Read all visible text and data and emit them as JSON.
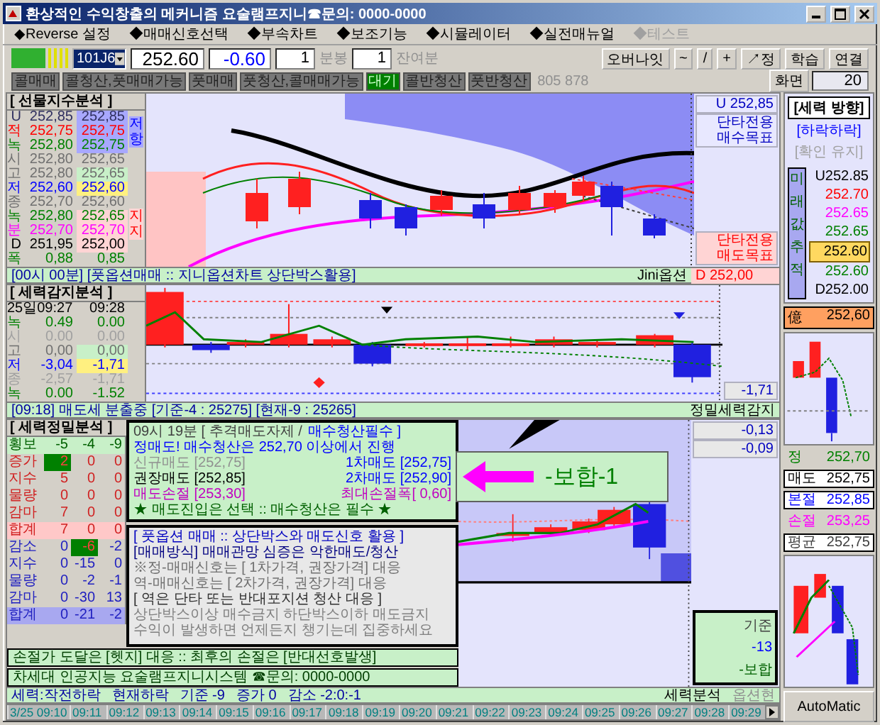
{
  "window": {
    "title": "환상적인 수익창출의 메커니즘 요술램프지니☎문의: 0000-0000"
  },
  "menu": [
    {
      "label": "◆Reverse 설정",
      "disabled": false
    },
    {
      "label": "◆매매신호선택",
      "disabled": false
    },
    {
      "label": "◆부속차트",
      "disabled": false
    },
    {
      "label": "◆보조기능",
      "disabled": false
    },
    {
      "label": "◆시뮬레이터",
      "disabled": false
    },
    {
      "label": "◆실전매뉴얼",
      "disabled": false
    },
    {
      "label": "◆테스트",
      "disabled": true
    }
  ],
  "toolbar": {
    "symbol": "101J6",
    "price": "252.60",
    "change": "-0.60",
    "interval": "1",
    "interval_unit": "분봉",
    "remaining": "1",
    "remaining_unit": "잔여분",
    "buttons": [
      "오버나잇",
      "~",
      "/",
      "+",
      "↗정",
      "학습",
      "연결"
    ]
  },
  "signals": [
    {
      "label": "콜매매",
      "active": false
    },
    {
      "label": "콜청산,풋매매가능",
      "active": false
    },
    {
      "label": "풋매매",
      "active": false
    },
    {
      "label": "풋청산,콜매매가능",
      "active": false
    },
    {
      "label": "대기",
      "active": true
    },
    {
      "label": "콜반청산",
      "active": false
    },
    {
      "label": "풋반청산",
      "active": false
    }
  ],
  "signal_counts": "805 878",
  "screen": {
    "label": "화면",
    "value": "20"
  },
  "futures": {
    "title": "[ 선물지수분석 ]",
    "resistance": "저항",
    "support": "지지",
    "rows": [
      {
        "label": "U",
        "color": "#303060",
        "values": [
          "252,85",
          "252,85"
        ],
        "kind": "resistance"
      },
      {
        "label": "적",
        "color": "#ff0000",
        "values": [
          "252,75",
          "252,75"
        ],
        "kind": "resistance"
      },
      {
        "label": "녹",
        "color": "#008000",
        "values": [
          "252,80",
          "252,75"
        ],
        "kind": "resistance"
      },
      {
        "label": "시",
        "color": "#707070",
        "values": [
          "252,80",
          "252,65"
        ],
        "kind": "plain"
      },
      {
        "label": "고",
        "color": "#707070",
        "values": [
          "252,80",
          "252,65"
        ],
        "kind": "high"
      },
      {
        "label": "저",
        "color": "#0000ff",
        "values": [
          "252,60",
          "252,60"
        ],
        "kind": "low"
      },
      {
        "label": "종",
        "color": "#707070",
        "values": [
          "252,70",
          "252,60"
        ],
        "kind": "plain"
      },
      {
        "label": "녹",
        "color": "#008000",
        "values": [
          "252,80",
          "252,65"
        ],
        "kind": "support"
      },
      {
        "label": "분",
        "color": "#ff00ff",
        "values": [
          "252,70",
          "252,70"
        ],
        "kind": "support"
      },
      {
        "label": "D",
        "color": "#000000",
        "values": [
          "251,95",
          "252,00"
        ],
        "kind": "support"
      },
      {
        "label": "폭",
        "color": "#008000",
        "values": [
          "0,88",
          "0,85"
        ],
        "kind": "plain"
      }
    ]
  },
  "futures_targets": {
    "upper": "U 252,85",
    "buy_target": "단타전용 매수목표",
    "sell_target": "단타전용 매도목표"
  },
  "futures_footer": {
    "text": "[00시 00분] [풋옵션매매 :: 지니옵션차트 상단박스활용]",
    "source": "Jini옵션",
    "lower": "D 252,00"
  },
  "detector": {
    "title": "[ 세력감지분석 ]",
    "columns": [
      "25일09:27",
      "09:28"
    ],
    "reading": "-1,71",
    "rows": [
      {
        "label": "녹",
        "color": "#008000",
        "values": [
          "0.49",
          "0.00"
        ],
        "kind": "plain"
      },
      {
        "label": "시",
        "color": "#a0a0a0",
        "values": [
          "0.00",
          "0.00"
        ],
        "kind": "plain"
      },
      {
        "label": "고",
        "color": "#707070",
        "values": [
          "0,00",
          "0,00"
        ],
        "kind": "high"
      },
      {
        "label": "저",
        "color": "#0000ff",
        "values": [
          "-3,04",
          "-1,71"
        ],
        "kind": "low"
      },
      {
        "label": "종",
        "color": "#a0a0a0",
        "values": [
          "-2,57",
          "-1,71"
        ],
        "kind": "plain"
      },
      {
        "label": "녹",
        "color": "#008000",
        "values": [
          "0.00",
          "-1.52"
        ],
        "kind": "plain"
      }
    ]
  },
  "detector_footer": {
    "text": "[09:18] 매도세 분출중 [기준-4 : 25275] [현재-9 : 25265]",
    "label": "정밀세력감지"
  },
  "precision": {
    "title": "[ 세력정밀분석 ]",
    "header": {
      "label": "횡보",
      "values": [
        "-5",
        "-4",
        "-9"
      ]
    },
    "rows": [
      {
        "label": "증가",
        "kind": "up",
        "values": [
          {
            "text": "2",
            "highlight": true
          },
          {
            "text": "0",
            "highlight": false
          },
          {
            "text": "0",
            "highlight": false
          }
        ]
      },
      {
        "label": "지수",
        "kind": "up",
        "values": [
          {
            "text": "5",
            "highlight": false
          },
          {
            "text": "0",
            "highlight": false
          },
          {
            "text": "0",
            "highlight": false
          }
        ]
      },
      {
        "label": "물량",
        "kind": "up",
        "values": [
          {
            "text": "0",
            "highlight": false
          },
          {
            "text": "0",
            "highlight": false
          },
          {
            "text": "0",
            "highlight": false
          }
        ]
      },
      {
        "label": "감마",
        "kind": "up",
        "values": [
          {
            "text": "7",
            "highlight": false
          },
          {
            "text": "0",
            "highlight": false
          },
          {
            "text": "0",
            "highlight": false
          }
        ]
      },
      {
        "label": "합계",
        "kind": "up_total",
        "values": [
          {
            "text": "7",
            "highlight": false
          },
          {
            "text": "0",
            "highlight": false
          },
          {
            "text": "0",
            "highlight": false
          }
        ]
      },
      {
        "label": "감소",
        "kind": "down",
        "values": [
          {
            "text": "0",
            "highlight": false
          },
          {
            "text": "-6",
            "highlight": true
          },
          {
            "text": "-2",
            "highlight": false
          }
        ]
      },
      {
        "label": "지수",
        "kind": "down",
        "values": [
          {
            "text": "0",
            "highlight": false
          },
          {
            "text": "-15",
            "highlight": false
          },
          {
            "text": "0",
            "highlight": false
          }
        ]
      },
      {
        "label": "물량",
        "kind": "down",
        "values": [
          {
            "text": "0",
            "highlight": false
          },
          {
            "text": "-2",
            "highlight": false
          },
          {
            "text": "-1",
            "highlight": false
          }
        ]
      },
      {
        "label": "감마",
        "kind": "down",
        "values": [
          {
            "text": "0",
            "highlight": false
          },
          {
            "text": "-30",
            "highlight": false
          },
          {
            "text": "13",
            "highlight": false
          }
        ]
      },
      {
        "label": "합계",
        "kind": "down_total",
        "values": [
          {
            "text": "0",
            "highlight": false
          },
          {
            "text": "-21",
            "highlight": false
          },
          {
            "text": "-2",
            "highlight": false
          }
        ]
      }
    ]
  },
  "advice": [
    {
      "kind": "single",
      "parts": [
        {
          "text": "09시 19분 [ 추격매도자제 /",
          "color": "#404040"
        },
        {
          "text": "매수청산필수 ]",
          "color": "#0000ff"
        }
      ]
    },
    {
      "kind": "single",
      "parts": [
        {
          "text": "정매도! 매수청산은 252,70 이상에서 진행",
          "color": "#0000ff"
        }
      ]
    },
    {
      "kind": "split",
      "parts": [
        {
          "text": "신규매도 [252,75]",
          "color": "#909090"
        },
        {
          "text": "1차매도 [252,75]",
          "color": "#0000ff"
        }
      ]
    },
    {
      "kind": "split",
      "parts": [
        {
          "text": "권장매도 [252,85]",
          "color": "#000000"
        },
        {
          "text": "2차매도 [252,90]",
          "color": "#0000ff"
        }
      ]
    },
    {
      "kind": "split",
      "parts": [
        {
          "text": "매도손절 [253,30]",
          "color": "#c000c0"
        },
        {
          "text": "최대손절폭[ 0,60]",
          "color": "#c000c0"
        }
      ]
    },
    {
      "kind": "single",
      "parts": [
        {
          "text": "★ 매도진입은 선택 :: 매수청산은 필수 ★",
          "color": "#006000"
        }
      ]
    }
  ],
  "strategy": [
    {
      "text": "[ 풋옵션 매매 :: 상단박스와 매도신호 활용 ]",
      "color": "#0000c0"
    },
    {
      "text": "[매매방식] 매매관망 심증은 악한매도/청산",
      "color": "#000080"
    },
    {
      "text": "※정-매매신호는 [ 1차가격, 권장가격] 대응",
      "color": "#707070"
    },
    {
      "text": "역-매매신호는 [ 2차가격, 권장가격] 대응",
      "color": "#707070"
    },
    {
      "text": "[ 역은 단타 또는 반대포지션 청산 대응 ]",
      "color": "#303030"
    },
    {
      "text": "상단박스이상 매수금지  하단박스이하 매도금지",
      "color": "#808080"
    },
    {
      "text": "수익이 발생하면 언제든지 챙기는데 집중하세요",
      "color": "#808080"
    }
  ],
  "notices": [
    "손절가 도달은 [헷지] 대응 :: 최후의 손절은 [반대선호발생]",
    "차세대 인공지능 요술램프지니시스템 ☎문의: 0000-0000"
  ],
  "trend_callout": "-보합-1",
  "readings": [
    "-0,13",
    "-0,09"
  ],
  "basis": {
    "label": "기준",
    "value": "-13",
    "state": "-보합"
  },
  "status": [
    "세력:작전하락",
    "현재하락",
    "기준 -9",
    "증가 0",
    "감소 -2:0:-1"
  ],
  "panel_labels": [
    "세력분석",
    "옵션현"
  ],
  "time_axis": [
    "3/25 09:10",
    "09:11",
    "09:12",
    "09:13",
    "09:14",
    "09:15",
    "09:16",
    "09:17",
    "09:18",
    "09:19",
    "09:20",
    "09:21",
    "09:22",
    "09:23",
    "09:24",
    "09:25",
    "09:26",
    "09:27",
    "09:28",
    "09:29"
  ],
  "direction": {
    "title": "[세력 방향]",
    "state": "[하락하락]",
    "note": "[확인 유지]",
    "tracker": "미래값추적",
    "values": [
      {
        "text": "U252.85",
        "color": "#000000",
        "highlight": false
      },
      {
        "text": "252.70",
        "color": "#ff0000",
        "highlight": false
      },
      {
        "text": "252.65",
        "color": "#ff00ff",
        "highlight": false
      },
      {
        "text": "252.65",
        "color": "#008000",
        "highlight": false
      },
      {
        "text": "252.60",
        "highlight": true
      },
      {
        "text": "252.60",
        "color": "#008000",
        "highlight": false
      },
      {
        "text": "D252.00",
        "color": "#000000",
        "highlight": false
      }
    ],
    "total_label": "億",
    "total": "252,60"
  },
  "positions": [
    {
      "label": "정",
      "value": "252,70",
      "color": "#008000",
      "boxed": false
    },
    {
      "label": "매도",
      "value": "252,75",
      "color": "#000000",
      "boxed": true
    },
    {
      "label": "본절",
      "value": "252,85",
      "color": "#0000ff",
      "boxed": true
    },
    {
      "label": "손절",
      "value": "253,25",
      "color": "#ff00ff",
      "boxed": false
    },
    {
      "label": "평균",
      "value": "252,75",
      "color": "#404040",
      "boxed": true
    }
  ],
  "automatic": "AutoMatic"
}
